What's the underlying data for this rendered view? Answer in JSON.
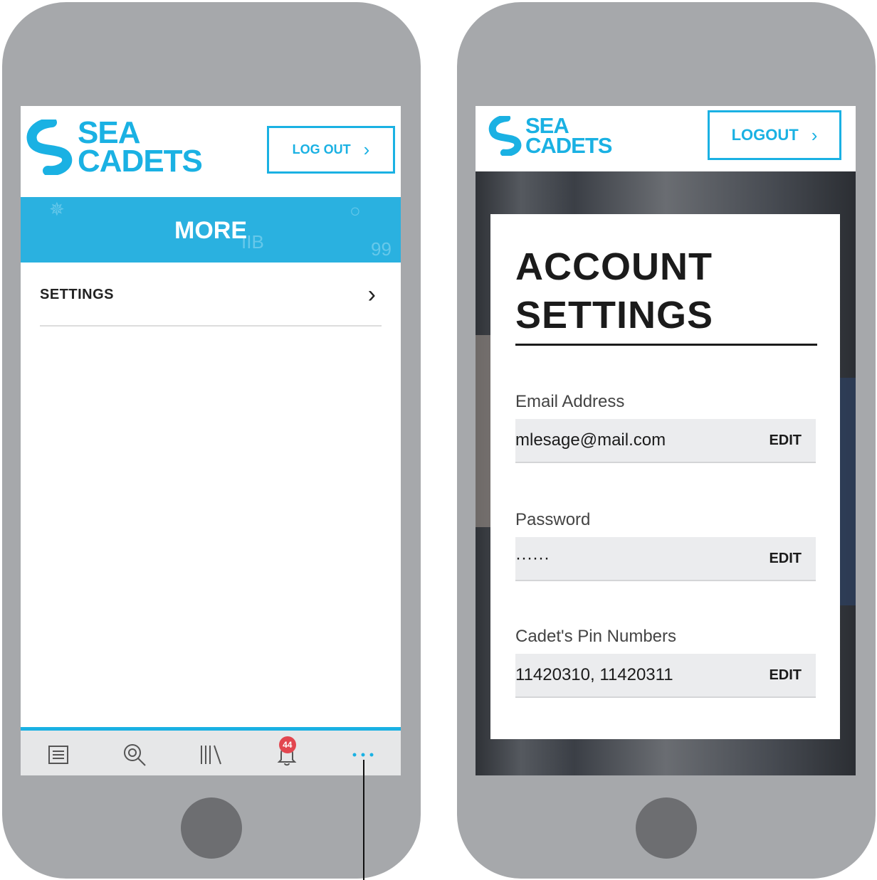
{
  "left_screen": {
    "logo": {
      "line1": "SEA",
      "line2": "CADETS"
    },
    "logout_label": "LOG OUT",
    "section_title": "MORE",
    "band_decor": [
      "IIB",
      "99"
    ],
    "menu_items": [
      {
        "label": "SETTINGS"
      }
    ],
    "tabbar": {
      "tabs": [
        {
          "icon": "list-icon"
        },
        {
          "icon": "search-icon"
        },
        {
          "icon": "library-icon"
        },
        {
          "icon": "notification-bell-icon",
          "badge": "44"
        },
        {
          "icon": "more-dots-icon",
          "active": true
        }
      ]
    }
  },
  "right_screen": {
    "logo": {
      "line1": "SEA",
      "line2": "CADETS"
    },
    "logout_label": "LOGOUT",
    "page_title_line1": "ACCOUNT",
    "page_title_line2": "SETTINGS",
    "fields": [
      {
        "label": "Email Address",
        "value": "mlesage@mail.com",
        "action": "EDIT"
      },
      {
        "label": "Password",
        "value": "······",
        "action": "EDIT"
      },
      {
        "label": "Cadet's Pin Numbers",
        "value": "11420310, 11420311",
        "action": "EDIT"
      }
    ]
  },
  "colors": {
    "brand": "#1ab1e3",
    "phone_body": "#a6a8ab",
    "badge": "#e2464f"
  }
}
